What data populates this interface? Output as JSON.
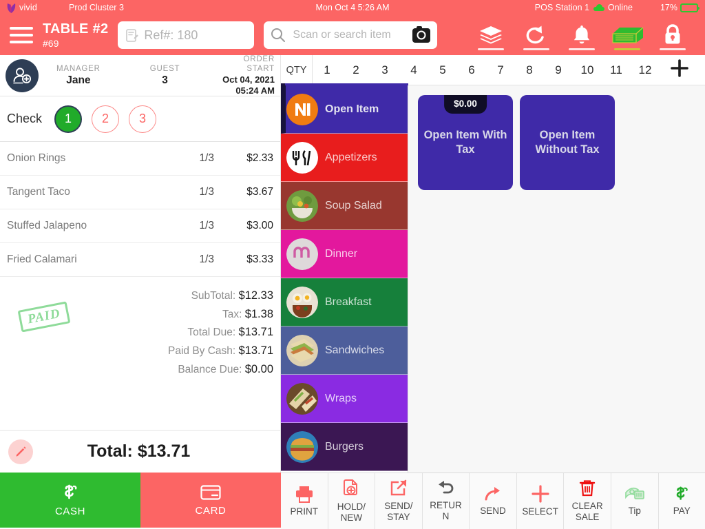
{
  "statusbar": {
    "brand": "vivid",
    "cluster": "Prod Cluster 3",
    "datetime": "Mon Oct 4 5:26 AM",
    "station": "POS Station 1",
    "connection": "Online",
    "battery": "17%",
    "battery_level": 17,
    "online_color": "#2fc72f"
  },
  "header": {
    "table_title": "TABLE #2",
    "table_sub": "#69",
    "ref_value": "Ref#: 180",
    "search_placeholder": "Scan or search item",
    "accent": "#fc6564",
    "icons": [
      {
        "name": "layers-icon",
        "active": false
      },
      {
        "name": "refresh-icon",
        "active": false
      },
      {
        "name": "bell-icon",
        "active": false
      },
      {
        "name": "cash-drawer-icon",
        "active": true
      },
      {
        "name": "lock-icon",
        "active": false
      }
    ]
  },
  "order": {
    "manager_label": "MANAGER",
    "manager_value": "Jane",
    "guest_label": "GUEST",
    "guest_value": "3",
    "start_label": "ORDER START",
    "start_date": "Oct 04, 2021",
    "start_time": "05:24 AM",
    "check_label": "Check",
    "checks": [
      {
        "number": "1",
        "selected": true
      },
      {
        "number": "2",
        "selected": false
      },
      {
        "number": "3",
        "selected": false
      }
    ],
    "items": [
      {
        "name": "Onion Rings",
        "qty": "1/3",
        "price": "$2.33"
      },
      {
        "name": "Tangent Taco",
        "qty": "1/3",
        "price": "$3.67"
      },
      {
        "name": "Stuffed Jalapeno",
        "qty": "1/3",
        "price": "$3.00"
      },
      {
        "name": "Fried Calamari",
        "qty": "1/3",
        "price": "$3.33"
      }
    ],
    "stamp": "PAID",
    "totals": [
      {
        "label": "SubTotal:",
        "value": "$12.33"
      },
      {
        "label": "Tax:",
        "value": "$1.38"
      },
      {
        "label": "Total Due:",
        "value": "$13.71"
      },
      {
        "label": "Paid By Cash:",
        "value": "$13.71"
      },
      {
        "label": "Balance Due:",
        "value": "$0.00"
      }
    ],
    "total_text": "Total: $13.71",
    "cash_label": "CASH",
    "card_label": "CARD"
  },
  "catalog": {
    "qty_label": "QTY",
    "quantities": [
      "1",
      "2",
      "3",
      "4",
      "5",
      "6",
      "7",
      "8",
      "9",
      "10",
      "11",
      "12"
    ],
    "add_label": "+",
    "categories": [
      {
        "label": "Open Item",
        "color": "#3f2aa8",
        "selected": true
      },
      {
        "label": "Appetizers",
        "color": "#e81d1d",
        "selected": false
      },
      {
        "label": "Soup Salad",
        "color": "#98372f",
        "selected": false
      },
      {
        "label": "Dinner",
        "color": "#e3189d",
        "selected": false
      },
      {
        "label": "Breakfast",
        "color": "#16803b",
        "selected": false
      },
      {
        "label": "Sandwiches",
        "color": "#4d5e9b",
        "selected": false
      },
      {
        "label": "Wraps",
        "color": "#8a2be2",
        "selected": false
      },
      {
        "label": "Burgers",
        "color": "#3b1753",
        "selected": false
      }
    ],
    "tiles": [
      {
        "label": "Open Item With Tax",
        "badge": "$0.00"
      },
      {
        "label": "Open Item Without Tax",
        "badge": ""
      }
    ]
  },
  "toolbar": {
    "buttons": [
      {
        "label": "PRINT",
        "icon": "printer-icon",
        "color": "#fc6564"
      },
      {
        "label": "HOLD/ NEW",
        "icon": "hold-new-icon",
        "color": "#fc6564"
      },
      {
        "label": "SEND/ STAY",
        "icon": "send-stay-icon",
        "color": "#fc6564"
      },
      {
        "label": "RETUR N",
        "icon": "return-icon",
        "color": "#5b5b5b"
      },
      {
        "label": "SEND",
        "icon": "send-icon",
        "color": "#fc6564"
      },
      {
        "label": "SELECT",
        "icon": "plus-icon",
        "color": "#fc6564"
      },
      {
        "label": "CLEAR SALE",
        "icon": "trash-icon",
        "color": "#ee1111"
      },
      {
        "label": "Tip",
        "icon": "money-icon",
        "color": "#8fdb9a"
      },
      {
        "label": "PAY",
        "icon": "dollar-icon",
        "color": "#21ab2a"
      }
    ]
  }
}
